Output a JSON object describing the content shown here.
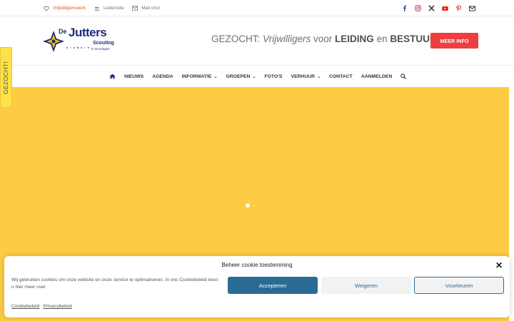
{
  "topbar": {
    "links": [
      {
        "label": "Vrijwilligerswerk",
        "icon": "heart-icon"
      },
      {
        "label": "Ledensite",
        "icon": "users-icon"
      },
      {
        "label": "Mail ons!",
        "icon": "envelope-icon"
      }
    ],
    "social": [
      "facebook-icon",
      "instagram-icon",
      "x-icon",
      "youtube-icon",
      "pinterest-icon",
      "mail-icon"
    ]
  },
  "logo": {
    "line1": "De",
    "line2": "Jutters",
    "line3": "Scouting",
    "line4": "in Groningen"
  },
  "headline": {
    "part1": "GEZOCHT: ",
    "part2": "Vrijwilligers",
    "part3": " voor ",
    "part4": "LEIDING",
    "part5": " en ",
    "part6": "BESTUUR",
    "part7": "!"
  },
  "cta": {
    "label": "MEER INFO"
  },
  "nav": {
    "items": [
      {
        "label": "NIEUWS",
        "dropdown": false
      },
      {
        "label": "AGENDA",
        "dropdown": false
      },
      {
        "label": "INFORMATIE",
        "dropdown": true
      },
      {
        "label": "GROEPEN",
        "dropdown": true
      },
      {
        "label": "FOTO'S",
        "dropdown": false
      },
      {
        "label": "VERHUUR",
        "dropdown": true
      },
      {
        "label": "CONTACT",
        "dropdown": false
      },
      {
        "label": "AANMELDEN",
        "dropdown": false
      }
    ]
  },
  "sidetab": {
    "label": "GEZOCHT!"
  },
  "colors": {
    "accent": "#f03e40",
    "hero": "#fdcc44",
    "brand": "#1c2b7b",
    "cookie_button": "#2a6b96"
  },
  "cookie": {
    "title": "Beheer cookie toestemming",
    "message": "Wij gebruiken cookies om onze website en onze service te optimaliseren. In ons Cookiebeleid leest u hier meer over",
    "accept": "Accepteren",
    "deny": "Weigeren",
    "preferences": "Voorkeuren",
    "link1": "Cookiebeleid",
    "link2": "Privacybeleid"
  }
}
